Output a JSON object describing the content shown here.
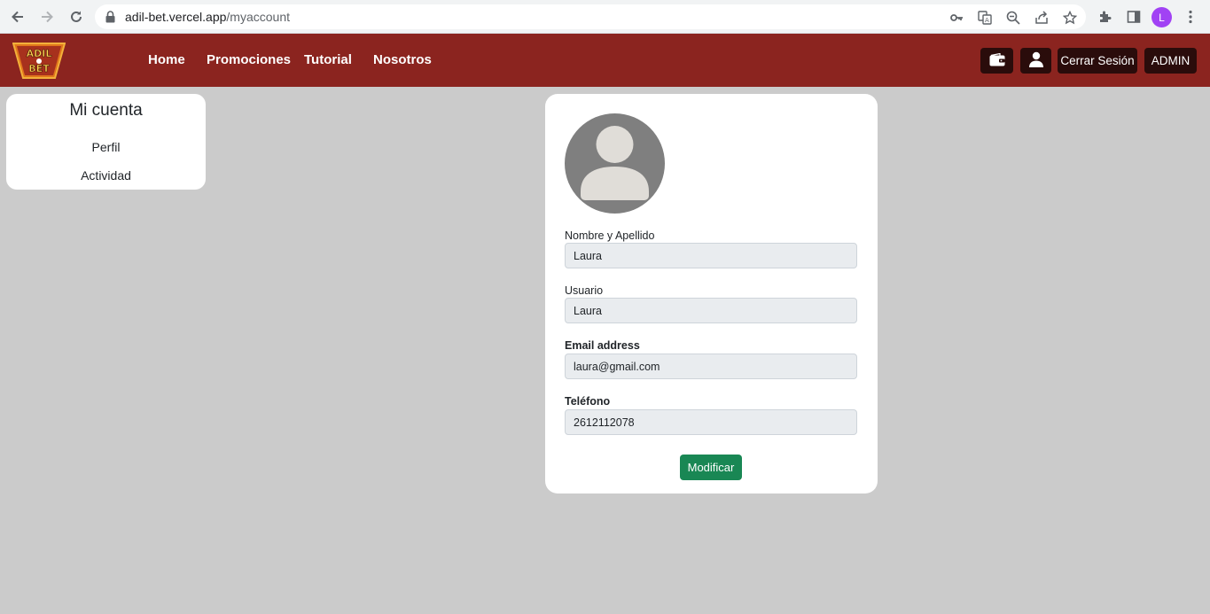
{
  "browser": {
    "url_domain": "adil-bet.vercel.app",
    "url_path": "/myaccount",
    "profile_initial": "L"
  },
  "navbar": {
    "logo_top": "ADIL",
    "logo_bottom": "BET",
    "links": [
      "Home",
      "Promociones",
      "Tutorial",
      "Nosotros"
    ],
    "logout_label": "Cerrar Sesión",
    "admin_label": "ADMIN",
    "icons": [
      "wallet-icon",
      "user-icon"
    ]
  },
  "sidebar": {
    "title": "Mi cuenta",
    "items": [
      "Perfil",
      "Actividad"
    ]
  },
  "profile": {
    "fields": [
      {
        "label": "Nombre y Apellido",
        "value": "Laura"
      },
      {
        "label": "Usuario",
        "value": "Laura"
      },
      {
        "label": "Email address",
        "value": "laura@gmail.com"
      },
      {
        "label": "Teléfono",
        "value": "2612112078"
      }
    ],
    "submit_label": "Modificar"
  },
  "colors": {
    "navbar": "#8b241f",
    "nav_button": "#2a0c0b",
    "page_bg": "#cbcbcb",
    "submit": "#198754"
  }
}
